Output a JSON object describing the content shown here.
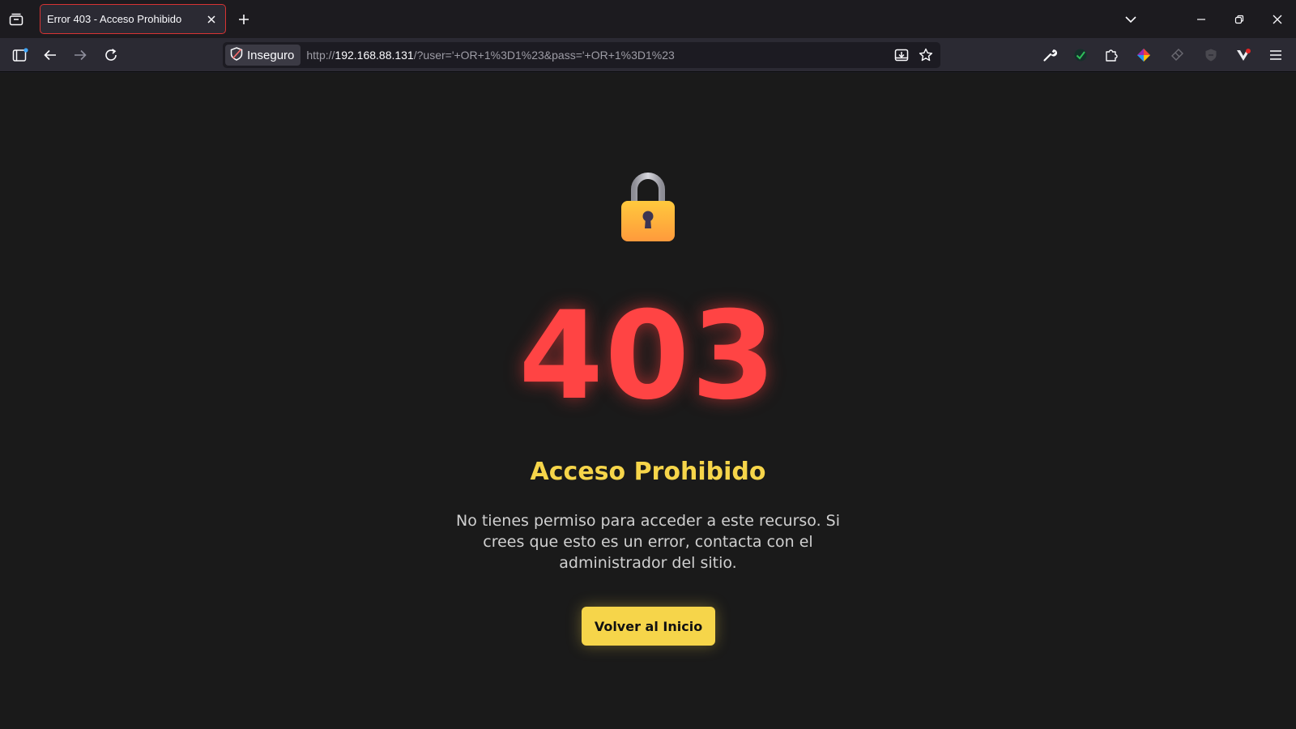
{
  "browser": {
    "tab": {
      "title": "Error 403 - Acceso Prohibido"
    },
    "urlbar": {
      "security_label": "Inseguro",
      "url_scheme": "http://",
      "url_host": "192.168.88.131",
      "url_rest": "/?user='+OR+1%3D1%23&pass='+OR+1%3D1%23"
    },
    "icons": {
      "tab_list": "tab-list-icon",
      "close_tab": "close-icon",
      "new_tab": "plus-icon",
      "all_tabs": "chevron-down-icon",
      "minimize": "minimize-icon",
      "restore": "restore-icon",
      "close_window": "close-icon",
      "sidebar": "sidebar-icon",
      "back": "back-arrow-icon",
      "forward": "forward-arrow-icon",
      "reload": "reload-icon",
      "shield": "shield-slash-icon",
      "install": "install-app-icon",
      "bookmark": "star-icon",
      "devtools": "wrench-icon",
      "extensions": "puzzle-icon",
      "menu": "hamburger-menu-icon"
    }
  },
  "page": {
    "icon": "lock-icon",
    "code": "403",
    "title": "Acceso Prohibido",
    "message": "No tienes permiso para acceder a este recurso. Si crees que esto es un error, contacta con el administrador del sitio.",
    "button_label": "Volver al Inicio"
  },
  "colors": {
    "code": "#ff4444",
    "title": "#f6d54a",
    "button_bg": "#f6d54a",
    "page_bg": "#1a1a1a",
    "tab_border": "#d73333"
  }
}
